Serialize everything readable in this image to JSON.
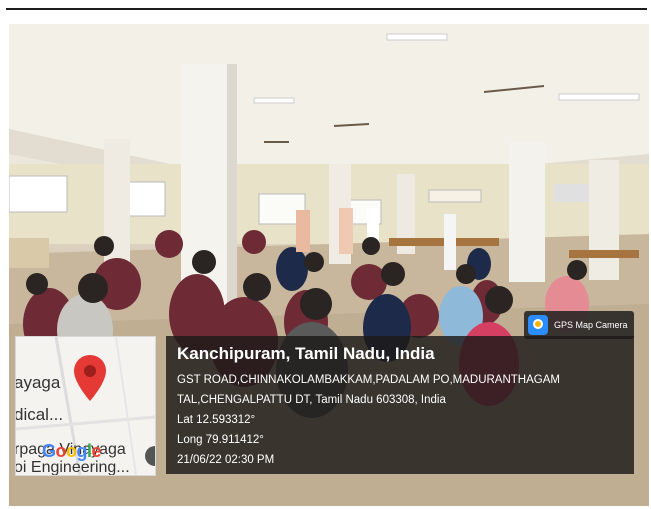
{
  "gps_camera": {
    "label": "GPS Map Camera",
    "icon": "gps-camera-icon"
  },
  "map": {
    "place_lines": [
      "ayaga",
      "dical...",
      "rpaga Vinayaga",
      "oi Engineering..."
    ],
    "logo": "Google",
    "pin_icon": "map-pin-icon",
    "pin_color": "#e53935"
  },
  "location": {
    "title": "Kanchipuram, Tamil Nadu, India",
    "address_line1": "GST ROAD,CHINNAKOLAMBAKKAM,PADALAM PO,MADURANTHAGAM",
    "address_line2": "TAL,CHENGALPATTU DT, Tamil Nadu 603308, India",
    "lat": "Lat 12.593312°",
    "long": "Long 79.911412°",
    "datetime": "21/06/22 02:30 PM"
  }
}
